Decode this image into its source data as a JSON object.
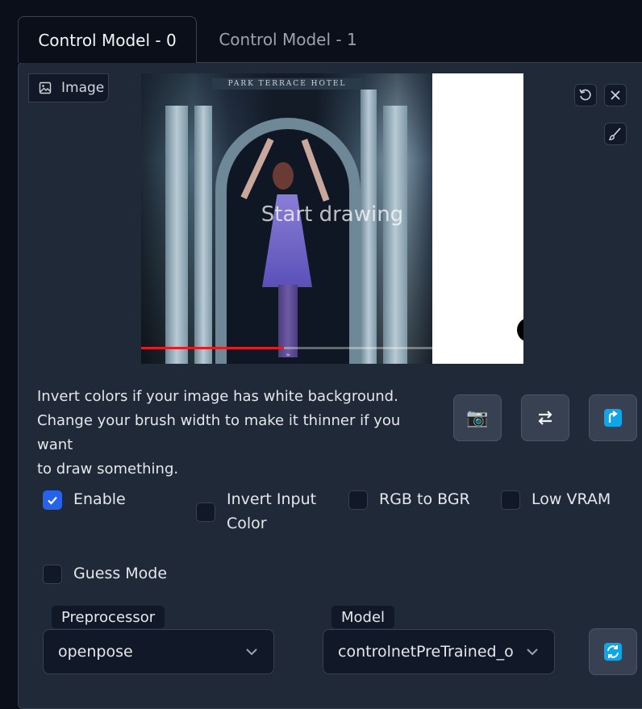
{
  "tabs": [
    {
      "label": "Control Model - 0",
      "active": true
    },
    {
      "label": "Control Model - 1",
      "active": false
    }
  ],
  "image_block": {
    "label": "Image",
    "canvas_placeholder": "Start drawing",
    "sign_text": "PARK TERRACE HOTEL",
    "video_progress_fraction": 0.49,
    "tools": [
      "undo-icon",
      "close-icon",
      "brush-icon"
    ]
  },
  "description": {
    "line1": "Invert colors if your image has white background.",
    "line2": "Change your brush width to make it thinner if you want",
    "line3": "to draw something."
  },
  "action_buttons": [
    {
      "icon": "camera-icon",
      "glyph": "📷"
    },
    {
      "icon": "swap-arrows-icon",
      "glyph": "⇄"
    },
    {
      "icon": "upload-arrow-icon",
      "glyph": "⤴"
    }
  ],
  "checkboxes": {
    "enable": {
      "label": "Enable",
      "checked": true
    },
    "invert_input": {
      "label_line1": "Invert Input",
      "label_line2": "Color",
      "checked": false
    },
    "rgb_to_bgr": {
      "label": "RGB to BGR",
      "checked": false
    },
    "low_vram": {
      "label": "Low VRAM",
      "checked": false
    },
    "guess_mode": {
      "label": "Guess Mode",
      "checked": false
    }
  },
  "preprocessor": {
    "label": "Preprocessor",
    "value": "openpose"
  },
  "model": {
    "label": "Model",
    "value": "controlnetPreTrained_o"
  },
  "refresh_button": {
    "icon": "refresh-icon"
  },
  "colors": {
    "accent": "#2563eb",
    "refresh_icon": "#0ea5e9",
    "progress": "#e11d24",
    "panel": "#1f2937",
    "background": "#0b0f19"
  }
}
